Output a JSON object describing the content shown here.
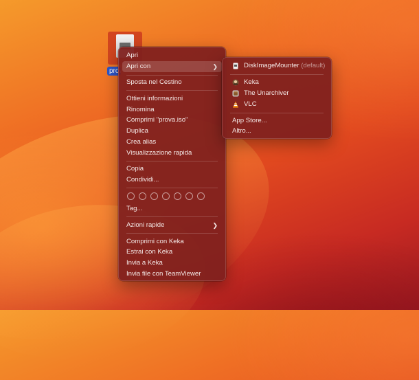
{
  "desktop": {
    "file_label": "prova.iso"
  },
  "context_menu": {
    "open": "Apri",
    "open_with": "Apri con",
    "move_to_trash": "Sposta nel Cestino",
    "get_info": "Ottieni informazioni",
    "rename": "Rinomina",
    "compress": "Comprimi \"prova.iso\"",
    "duplicate": "Duplica",
    "make_alias": "Crea alias",
    "quick_look": "Visualizzazione rapida",
    "copy": "Copia",
    "share": "Condividi...",
    "tags": "Tag...",
    "quick_actions": "Azioni rapide",
    "compress_keka": "Comprimi con Keka",
    "extract_keka": "Estrai con Keka",
    "send_keka": "Invia a Keka",
    "send_teamviewer": "Invia file con TeamViewer"
  },
  "open_with_menu": {
    "default_app": "DiskImageMounter",
    "default_suffix": "(default)",
    "apps": [
      "Keka",
      "The Unarchiver",
      "VLC"
    ],
    "app_store": "App Store...",
    "other": "Altro..."
  },
  "tag_colors_count": 7
}
